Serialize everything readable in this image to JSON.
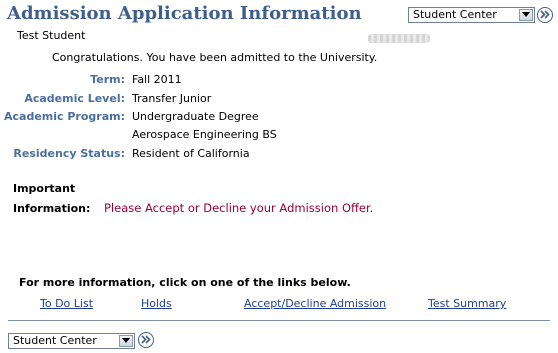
{
  "page": {
    "title": "Admission Application Information",
    "student_name": "Test Student",
    "congrats": "Congratulations.  You have been admitted to the University."
  },
  "nav_select": {
    "selected": "Student Center"
  },
  "details": [
    {
      "label": "Term:",
      "values": [
        "Fall 2011"
      ]
    },
    {
      "label": "Academic Level:",
      "values": [
        "Transfer Junior"
      ]
    },
    {
      "label": "Academic Program:",
      "values": [
        "Undergraduate Degree",
        "Aerospace Engineering BS"
      ]
    },
    {
      "label": "Residency Status:",
      "values": [
        "Resident of California"
      ]
    }
  ],
  "important": {
    "label_line1": "Important",
    "label_line2": "Information:",
    "message": "Please Accept or Decline your Admission Offer."
  },
  "more_info": "For more information, click on one of the links below.",
  "links": [
    "To Do List",
    "Holds",
    "Accept/Decline Admission",
    "Test Summary"
  ],
  "colors": {
    "title": "#3f5e8c",
    "label": "#4a6f9d",
    "message": "#990033",
    "link": "#1f3f8f"
  },
  "icons": {
    "go_button": "double-chevron-right-icon",
    "dropdown": "chevron-down-icon"
  }
}
